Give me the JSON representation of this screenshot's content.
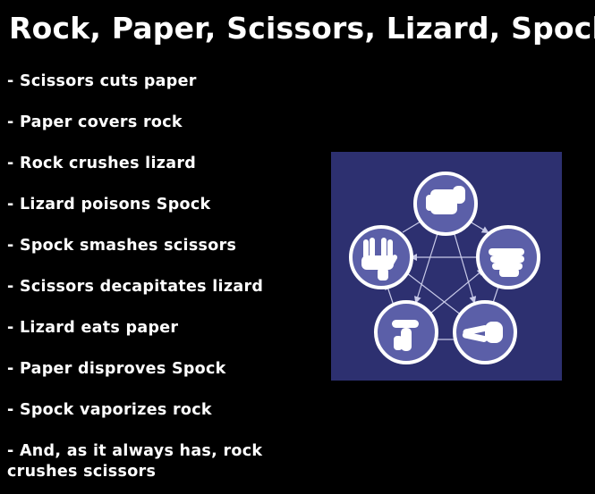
{
  "title": "Rock, Paper, Scissors, Lizard, Spock",
  "rules": [
    "- Scissors cuts paper",
    "- Paper covers rock",
    "- Rock crushes lizard",
    "- Lizard poisons Spock",
    "- Spock smashes scissors",
    "- Scissors decapitates lizard",
    "- Lizard eats paper",
    "- Paper disproves Spock",
    "- Spock vaporizes rock",
    "- And, as it always has, rock crushes scissors"
  ],
  "diagram": {
    "background_color": "#2d3070",
    "circle_color": "#5b5fa8",
    "ring_color": "#ffffff",
    "arrow_color": "#c8cae8",
    "hand_color": "#ffffff",
    "nodes": [
      {
        "name": "rock",
        "icon": "fist-icon"
      },
      {
        "name": "paper",
        "icon": "flat-hand-icon"
      },
      {
        "name": "scissors",
        "icon": "scissors-hand-icon"
      },
      {
        "name": "lizard",
        "icon": "lizard-hand-icon"
      },
      {
        "name": "spock",
        "icon": "vulcan-salute-icon"
      }
    ]
  }
}
